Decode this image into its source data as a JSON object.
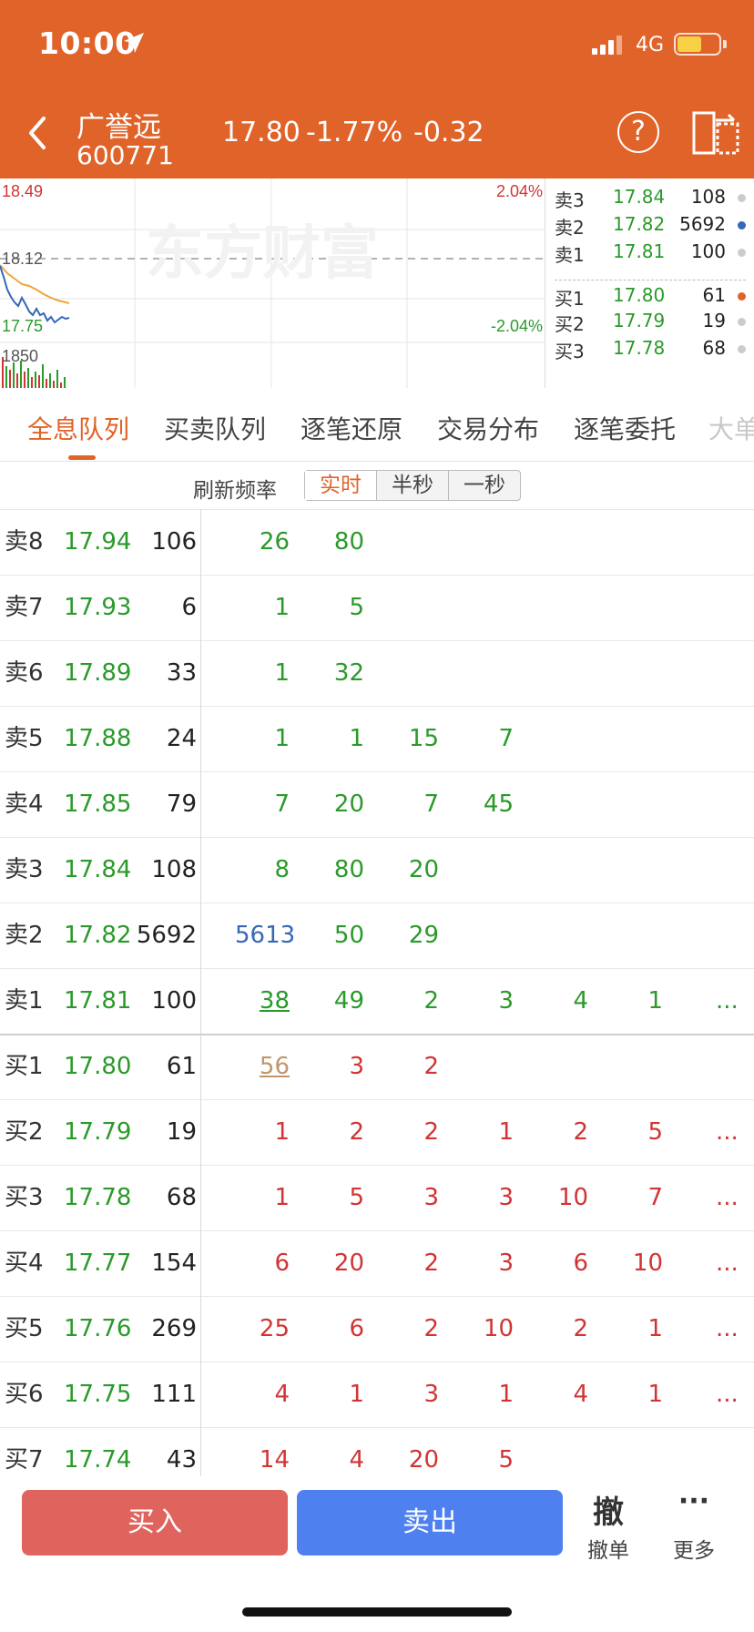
{
  "status_bar": {
    "time": "10:00",
    "network": "4G",
    "battery_fraction": 0.6
  },
  "header": {
    "stock_name": "广誉远",
    "stock_code": "600771",
    "price": "17.80",
    "change_pct": "-1.77%",
    "change": "-0.32",
    "help_glyph": "?"
  },
  "chart": {
    "high_label": "18.49",
    "mid_label": "18.12",
    "low_label": "17.75",
    "high_pct": "2.04%",
    "low_pct": "-2.04%",
    "volume_label": "1850",
    "watermark": "东方财富"
  },
  "depth": [
    {
      "label": "卖3",
      "price": "17.84",
      "volume": "108",
      "dot_color": "#cccccc"
    },
    {
      "label": "卖2",
      "price": "17.82",
      "volume": "5692",
      "dot_color": "#3568b8"
    },
    {
      "label": "卖1",
      "price": "17.81",
      "volume": "100",
      "dot_color": "#cccccc"
    },
    {
      "label": "买1",
      "price": "17.80",
      "volume": "61",
      "dot_color": "#e06329"
    },
    {
      "label": "买2",
      "price": "17.79",
      "volume": "19",
      "dot_color": "#cccccc"
    },
    {
      "label": "买3",
      "price": "17.78",
      "volume": "68",
      "dot_color": "#cccccc"
    }
  ],
  "tabs": [
    "全息队列",
    "买卖队列",
    "逐笔还原",
    "交易分布",
    "逐笔委托",
    "大单"
  ],
  "active_tab": 0,
  "refresh": {
    "label": "刷新频率",
    "options": [
      "实时",
      "半秒",
      "一秒"
    ],
    "active": 0
  },
  "queue_rows": [
    {
      "label": "卖8",
      "price": "17.94",
      "volume": "106",
      "orders": [
        "26",
        "80"
      ],
      "more": ""
    },
    {
      "label": "卖7",
      "price": "17.93",
      "volume": "6",
      "orders": [
        "1",
        "5"
      ],
      "more": ""
    },
    {
      "label": "卖6",
      "price": "17.89",
      "volume": "33",
      "orders": [
        "1",
        "32"
      ],
      "more": ""
    },
    {
      "label": "卖5",
      "price": "17.88",
      "volume": "24",
      "orders": [
        "1",
        "1",
        "15",
        "7"
      ],
      "more": ""
    },
    {
      "label": "卖4",
      "price": "17.85",
      "volume": "79",
      "orders": [
        "7",
        "20",
        "7",
        "45"
      ],
      "more": ""
    },
    {
      "label": "卖3",
      "price": "17.84",
      "volume": "108",
      "orders": [
        "8",
        "80",
        "20"
      ],
      "more": ""
    },
    {
      "label": "卖2",
      "price": "17.82",
      "volume": "5692",
      "orders": [
        "5613",
        "50",
        "29"
      ],
      "more": ""
    },
    {
      "label": "卖1",
      "price": "17.81",
      "volume": "100",
      "orders": [
        "38",
        "49",
        "2",
        "3",
        "4",
        "1"
      ],
      "more": "..."
    },
    {
      "label": "买1",
      "price": "17.80",
      "volume": "61",
      "orders": [
        "56",
        "3",
        "2"
      ],
      "more": ""
    },
    {
      "label": "买2",
      "price": "17.79",
      "volume": "19",
      "orders": [
        "1",
        "2",
        "2",
        "1",
        "2",
        "5"
      ],
      "more": "..."
    },
    {
      "label": "买3",
      "price": "17.78",
      "volume": "68",
      "orders": [
        "1",
        "5",
        "3",
        "3",
        "10",
        "7"
      ],
      "more": "..."
    },
    {
      "label": "买4",
      "price": "17.77",
      "volume": "154",
      "orders": [
        "6",
        "20",
        "2",
        "3",
        "6",
        "10"
      ],
      "more": "..."
    },
    {
      "label": "买5",
      "price": "17.76",
      "volume": "269",
      "orders": [
        "25",
        "6",
        "2",
        "10",
        "2",
        "1"
      ],
      "more": "..."
    },
    {
      "label": "买6",
      "price": "17.75",
      "volume": "111",
      "orders": [
        "4",
        "1",
        "3",
        "1",
        "4",
        "1"
      ],
      "more": "..."
    },
    {
      "label": "买7",
      "price": "17.74",
      "volume": "43",
      "orders": [
        "14",
        "4",
        "20",
        "5"
      ],
      "more": ""
    }
  ],
  "bottom_bar": {
    "buy_label": "买入",
    "sell_label": "卖出",
    "cancel_glyph": "撤",
    "cancel_label": "撤单",
    "more_glyph": "···",
    "more_label": "更多"
  },
  "colors": {
    "accent": "#e06329",
    "buy": "#e0645e",
    "sell": "#4f80f0",
    "up": "#d23434",
    "down": "#2a9a2a"
  }
}
